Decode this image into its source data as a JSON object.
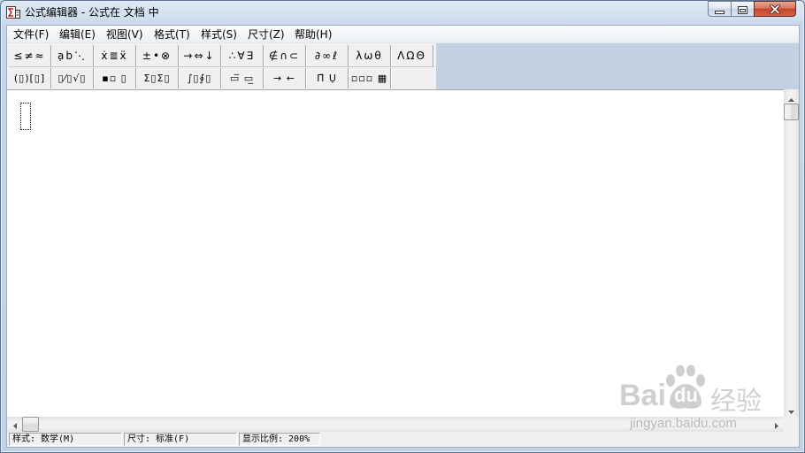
{
  "window": {
    "title": "公式编辑器 - 公式在 文档 中",
    "app_icon": "equation-editor-icon",
    "controls": [
      "minimize-icon",
      "maximize-icon",
      "close-icon"
    ]
  },
  "menu": [
    {
      "label": "文件(F)"
    },
    {
      "label": "编辑(E)"
    },
    {
      "label": "视图(V)"
    },
    {
      "label": "格式(T)"
    },
    {
      "label": "样式(S)"
    },
    {
      "label": "尺寸(Z)"
    },
    {
      "label": "帮助(H)"
    }
  ],
  "palettes": {
    "symbol_row": [
      {
        "icon": "relational-symbols-icon",
        "glyphs": "≤≠≈"
      },
      {
        "icon": "spaces-ellipses-icon",
        "glyphs": "ạb⋱"
      },
      {
        "icon": "embellishments-icon",
        "glyphs": "ẋ≣ẍ"
      },
      {
        "icon": "operator-symbols-icon",
        "glyphs": "±•⊗"
      },
      {
        "icon": "arrow-symbols-icon",
        "glyphs": "→⇔↓"
      },
      {
        "icon": "logical-symbols-icon",
        "glyphs": "∴∀∃"
      },
      {
        "icon": "set-theory-symbols-icon",
        "glyphs": "∉∩⊂"
      },
      {
        "icon": "misc-symbols-icon",
        "glyphs": "∂∞ℓ"
      },
      {
        "icon": "greek-lowercase-icon",
        "glyphs": "λωθ"
      },
      {
        "icon": "greek-uppercase-icon",
        "glyphs": "ΛΩΘ"
      }
    ],
    "template_row": [
      {
        "icon": "fence-templates-icon",
        "glyphs": "(▯)[▯]"
      },
      {
        "icon": "fraction-radical-templates-icon",
        "glyphs": "▯⁄▯√▯"
      },
      {
        "icon": "script-templates-icon",
        "glyphs": "▪▫ ▯"
      },
      {
        "icon": "summation-templates-icon",
        "glyphs": "Σ▯Σ▯"
      },
      {
        "icon": "integral-templates-icon",
        "glyphs": "∫▯∮▯"
      },
      {
        "icon": "bar-templates-icon",
        "glyphs": "▭̅ ▭̲"
      },
      {
        "icon": "labeled-arrow-templates-icon",
        "glyphs": "→ ←"
      },
      {
        "icon": "product-set-templates-icon",
        "glyphs": "Π̃ Ụ"
      },
      {
        "icon": "matrix-templates-icon",
        "glyphs": "▫▫▫ ▦"
      }
    ]
  },
  "status": {
    "style": "样式: 数学(M)",
    "size": "尺寸: 标准(F)",
    "zoom": "显示比例: 200%"
  },
  "watermark": {
    "brand_left": "Bai",
    "brand_paw_text": "du",
    "brand_cn": "经验",
    "url": "jingyan.baidu.com",
    "paw_icon": "baidu-paw-icon"
  },
  "colors": {
    "frame": "#c3d2e2",
    "close_button": "#c7472d",
    "palette_bg": "#f0f0f0",
    "canvas": "#ffffff",
    "watermark": "#a0a0a0"
  }
}
